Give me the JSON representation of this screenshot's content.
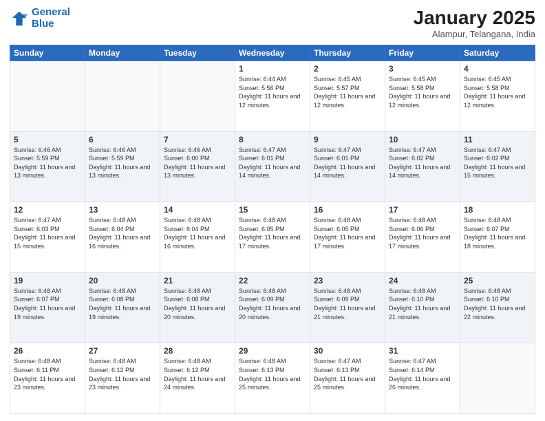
{
  "header": {
    "logo_line1": "General",
    "logo_line2": "Blue",
    "month": "January 2025",
    "location": "Alampur, Telangana, India"
  },
  "weekdays": [
    "Sunday",
    "Monday",
    "Tuesday",
    "Wednesday",
    "Thursday",
    "Friday",
    "Saturday"
  ],
  "weeks": [
    [
      {
        "day": "",
        "sunrise": "",
        "sunset": "",
        "daylight": ""
      },
      {
        "day": "",
        "sunrise": "",
        "sunset": "",
        "daylight": ""
      },
      {
        "day": "",
        "sunrise": "",
        "sunset": "",
        "daylight": ""
      },
      {
        "day": "1",
        "sunrise": "Sunrise: 6:44 AM",
        "sunset": "Sunset: 5:56 PM",
        "daylight": "Daylight: 11 hours and 12 minutes."
      },
      {
        "day": "2",
        "sunrise": "Sunrise: 6:45 AM",
        "sunset": "Sunset: 5:57 PM",
        "daylight": "Daylight: 11 hours and 12 minutes."
      },
      {
        "day": "3",
        "sunrise": "Sunrise: 6:45 AM",
        "sunset": "Sunset: 5:58 PM",
        "daylight": "Daylight: 11 hours and 12 minutes."
      },
      {
        "day": "4",
        "sunrise": "Sunrise: 6:45 AM",
        "sunset": "Sunset: 5:58 PM",
        "daylight": "Daylight: 11 hours and 12 minutes."
      }
    ],
    [
      {
        "day": "5",
        "sunrise": "Sunrise: 6:46 AM",
        "sunset": "Sunset: 5:59 PM",
        "daylight": "Daylight: 11 hours and 13 minutes."
      },
      {
        "day": "6",
        "sunrise": "Sunrise: 6:46 AM",
        "sunset": "Sunset: 5:59 PM",
        "daylight": "Daylight: 11 hours and 13 minutes."
      },
      {
        "day": "7",
        "sunrise": "Sunrise: 6:46 AM",
        "sunset": "Sunset: 6:00 PM",
        "daylight": "Daylight: 11 hours and 13 minutes."
      },
      {
        "day": "8",
        "sunrise": "Sunrise: 6:47 AM",
        "sunset": "Sunset: 6:01 PM",
        "daylight": "Daylight: 11 hours and 14 minutes."
      },
      {
        "day": "9",
        "sunrise": "Sunrise: 6:47 AM",
        "sunset": "Sunset: 6:01 PM",
        "daylight": "Daylight: 11 hours and 14 minutes."
      },
      {
        "day": "10",
        "sunrise": "Sunrise: 6:47 AM",
        "sunset": "Sunset: 6:02 PM",
        "daylight": "Daylight: 11 hours and 14 minutes."
      },
      {
        "day": "11",
        "sunrise": "Sunrise: 6:47 AM",
        "sunset": "Sunset: 6:02 PM",
        "daylight": "Daylight: 11 hours and 15 minutes."
      }
    ],
    [
      {
        "day": "12",
        "sunrise": "Sunrise: 6:47 AM",
        "sunset": "Sunset: 6:03 PM",
        "daylight": "Daylight: 11 hours and 15 minutes."
      },
      {
        "day": "13",
        "sunrise": "Sunrise: 6:48 AM",
        "sunset": "Sunset: 6:04 PM",
        "daylight": "Daylight: 11 hours and 16 minutes."
      },
      {
        "day": "14",
        "sunrise": "Sunrise: 6:48 AM",
        "sunset": "Sunset: 6:04 PM",
        "daylight": "Daylight: 11 hours and 16 minutes."
      },
      {
        "day": "15",
        "sunrise": "Sunrise: 6:48 AM",
        "sunset": "Sunset: 6:05 PM",
        "daylight": "Daylight: 11 hours and 17 minutes."
      },
      {
        "day": "16",
        "sunrise": "Sunrise: 6:48 AM",
        "sunset": "Sunset: 6:05 PM",
        "daylight": "Daylight: 11 hours and 17 minutes."
      },
      {
        "day": "17",
        "sunrise": "Sunrise: 6:48 AM",
        "sunset": "Sunset: 6:06 PM",
        "daylight": "Daylight: 11 hours and 17 minutes."
      },
      {
        "day": "18",
        "sunrise": "Sunrise: 6:48 AM",
        "sunset": "Sunset: 6:07 PM",
        "daylight": "Daylight: 11 hours and 18 minutes."
      }
    ],
    [
      {
        "day": "19",
        "sunrise": "Sunrise: 6:48 AM",
        "sunset": "Sunset: 6:07 PM",
        "daylight": "Daylight: 11 hours and 19 minutes."
      },
      {
        "day": "20",
        "sunrise": "Sunrise: 6:48 AM",
        "sunset": "Sunset: 6:08 PM",
        "daylight": "Daylight: 11 hours and 19 minutes."
      },
      {
        "day": "21",
        "sunrise": "Sunrise: 6:48 AM",
        "sunset": "Sunset: 6:08 PM",
        "daylight": "Daylight: 11 hours and 20 minutes."
      },
      {
        "day": "22",
        "sunrise": "Sunrise: 6:48 AM",
        "sunset": "Sunset: 6:09 PM",
        "daylight": "Daylight: 11 hours and 20 minutes."
      },
      {
        "day": "23",
        "sunrise": "Sunrise: 6:48 AM",
        "sunset": "Sunset: 6:09 PM",
        "daylight": "Daylight: 11 hours and 21 minutes."
      },
      {
        "day": "24",
        "sunrise": "Sunrise: 6:48 AM",
        "sunset": "Sunset: 6:10 PM",
        "daylight": "Daylight: 11 hours and 21 minutes."
      },
      {
        "day": "25",
        "sunrise": "Sunrise: 6:48 AM",
        "sunset": "Sunset: 6:10 PM",
        "daylight": "Daylight: 11 hours and 22 minutes."
      }
    ],
    [
      {
        "day": "26",
        "sunrise": "Sunrise: 6:48 AM",
        "sunset": "Sunset: 6:11 PM",
        "daylight": "Daylight: 11 hours and 23 minutes."
      },
      {
        "day": "27",
        "sunrise": "Sunrise: 6:48 AM",
        "sunset": "Sunset: 6:12 PM",
        "daylight": "Daylight: 11 hours and 23 minutes."
      },
      {
        "day": "28",
        "sunrise": "Sunrise: 6:48 AM",
        "sunset": "Sunset: 6:12 PM",
        "daylight": "Daylight: 11 hours and 24 minutes."
      },
      {
        "day": "29",
        "sunrise": "Sunrise: 6:48 AM",
        "sunset": "Sunset: 6:13 PM",
        "daylight": "Daylight: 11 hours and 25 minutes."
      },
      {
        "day": "30",
        "sunrise": "Sunrise: 6:47 AM",
        "sunset": "Sunset: 6:13 PM",
        "daylight": "Daylight: 11 hours and 25 minutes."
      },
      {
        "day": "31",
        "sunrise": "Sunrise: 6:47 AM",
        "sunset": "Sunset: 6:14 PM",
        "daylight": "Daylight: 11 hours and 26 minutes."
      },
      {
        "day": "",
        "sunrise": "",
        "sunset": "",
        "daylight": ""
      }
    ]
  ]
}
